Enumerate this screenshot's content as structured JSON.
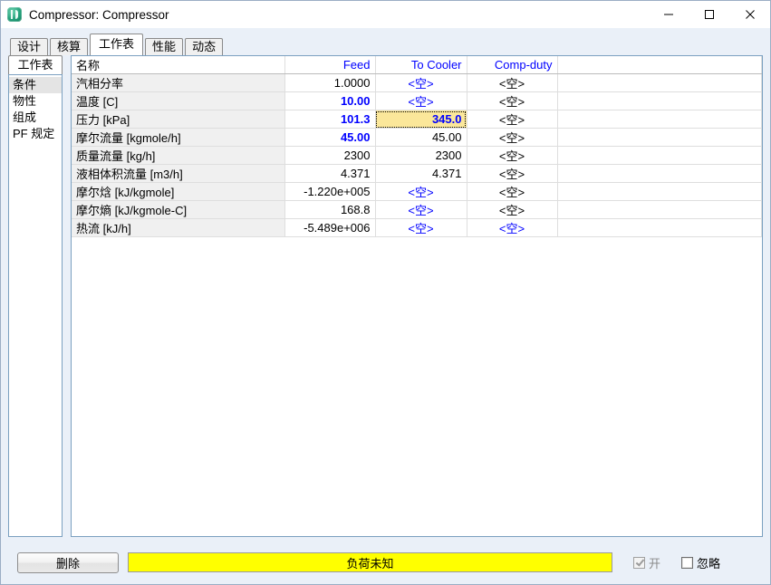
{
  "window": {
    "title": "Compressor: Compressor",
    "icon": "app-icon",
    "controls": {
      "minimize": "minimize-icon",
      "maximize": "maximize-icon",
      "close": "close-icon"
    }
  },
  "tabs": [
    {
      "label": "设计",
      "active": false
    },
    {
      "label": "核算",
      "active": false
    },
    {
      "label": "工作表",
      "active": true
    },
    {
      "label": "性能",
      "active": false
    },
    {
      "label": "动态",
      "active": false
    }
  ],
  "sidebar": {
    "header": "工作表",
    "items": [
      {
        "label": "条件",
        "selected": true
      },
      {
        "label": "物性",
        "selected": false
      },
      {
        "label": "组成",
        "selected": false
      },
      {
        "label": "PF 规定",
        "selected": false
      }
    ]
  },
  "worksheet": {
    "columns": [
      "名称",
      "Feed",
      "To Cooler",
      "Comp-duty"
    ],
    "rows": [
      {
        "name": "汽相分率",
        "cells": [
          {
            "text": "1.0000",
            "style": "black"
          },
          {
            "text": "<空>",
            "style": "empty"
          },
          {
            "text": "<空>",
            "style": "empty-black"
          }
        ]
      },
      {
        "name": "温度 [C]",
        "cells": [
          {
            "text": "10.00",
            "style": "blue"
          },
          {
            "text": "<空>",
            "style": "empty"
          },
          {
            "text": "<空>",
            "style": "empty-black"
          }
        ]
      },
      {
        "name": "压力 [kPa]",
        "cells": [
          {
            "text": "101.3",
            "style": "blue"
          },
          {
            "text": "345.0",
            "style": "selected"
          },
          {
            "text": "<空>",
            "style": "empty-black"
          }
        ]
      },
      {
        "name": "摩尔流量 [kgmole/h]",
        "cells": [
          {
            "text": "45.00",
            "style": "blue"
          },
          {
            "text": "45.00",
            "style": "black"
          },
          {
            "text": "<空>",
            "style": "empty-black"
          }
        ]
      },
      {
        "name": "质量流量 [kg/h]",
        "cells": [
          {
            "text": "2300",
            "style": "black"
          },
          {
            "text": "2300",
            "style": "black"
          },
          {
            "text": "<空>",
            "style": "empty-black"
          }
        ]
      },
      {
        "name": "液相体积流量 [m3/h]",
        "cells": [
          {
            "text": "4.371",
            "style": "black"
          },
          {
            "text": "4.371",
            "style": "black"
          },
          {
            "text": "<空>",
            "style": "empty-black"
          }
        ]
      },
      {
        "name": "摩尔焓 [kJ/kgmole]",
        "cells": [
          {
            "text": "-1.220e+005",
            "style": "black"
          },
          {
            "text": "<空>",
            "style": "empty"
          },
          {
            "text": "<空>",
            "style": "empty-black"
          }
        ]
      },
      {
        "name": "摩尔熵 [kJ/kgmole-C]",
        "cells": [
          {
            "text": "168.8",
            "style": "black"
          },
          {
            "text": "<空>",
            "style": "empty"
          },
          {
            "text": "<空>",
            "style": "empty-black"
          }
        ]
      },
      {
        "name": "热流 [kJ/h]",
        "cells": [
          {
            "text": "-5.489e+006",
            "style": "black"
          },
          {
            "text": "<空>",
            "style": "empty"
          },
          {
            "text": "<空>",
            "style": "empty"
          }
        ]
      }
    ]
  },
  "bottom": {
    "delete_label": "删除",
    "status_message": "负荷未知",
    "status_color": "#ffff00",
    "on_checkbox": {
      "label": "开",
      "checked": true,
      "disabled": true
    },
    "ignore_checkbox": {
      "label": "忽略",
      "checked": false,
      "disabled": false
    }
  }
}
